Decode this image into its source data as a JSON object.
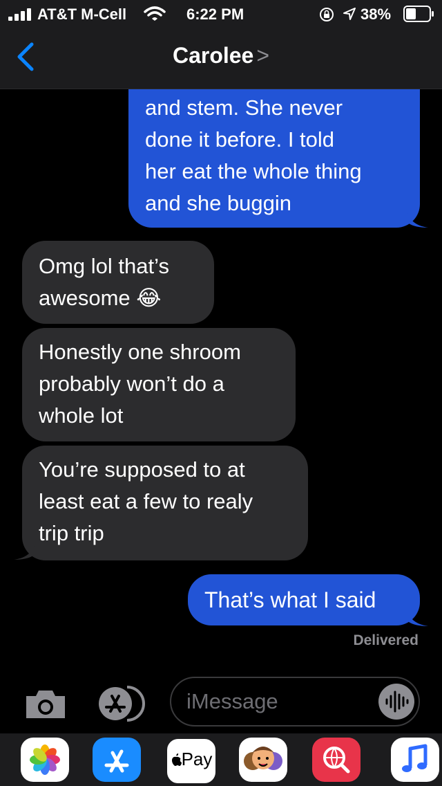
{
  "status": {
    "carrier": "AT&T M-Cell",
    "time": "6:22 PM",
    "battery_pct": "38%"
  },
  "header": {
    "title": "Carolee",
    "chevron": ">"
  },
  "messages": [
    {
      "dir": "out",
      "lines": [
        "and stem. She never",
        "done it before. I told",
        "her eat the whole thing",
        "and she buggin"
      ]
    },
    {
      "dir": "in",
      "lines": [
        "Omg lol that’s",
        "awesome 😂"
      ]
    },
    {
      "dir": "in",
      "lines": [
        "Honestly one shroom",
        "probably won’t do a",
        "whole lot"
      ]
    },
    {
      "dir": "in",
      "lines": [
        "You’re supposed to at",
        "least eat a few to realy",
        "trip trip"
      ]
    },
    {
      "dir": "out",
      "lines": [
        "That’s what I said"
      ]
    }
  ],
  "delivered_label": "Delivered",
  "composer": {
    "placeholder": "iMessage"
  },
  "app_drawer": {
    "apple_pay_label": "Pay",
    "apps": [
      "photos-app-icon",
      "app-store-app-icon",
      "apple-pay-app-icon",
      "memoji-app-icon",
      "web-search-app-icon",
      "music-app-icon"
    ]
  },
  "colors": {
    "outgoing_bubble": "#2254d6",
    "incoming_bubble": "#2c2c2e",
    "accent": "#0a84ff"
  }
}
